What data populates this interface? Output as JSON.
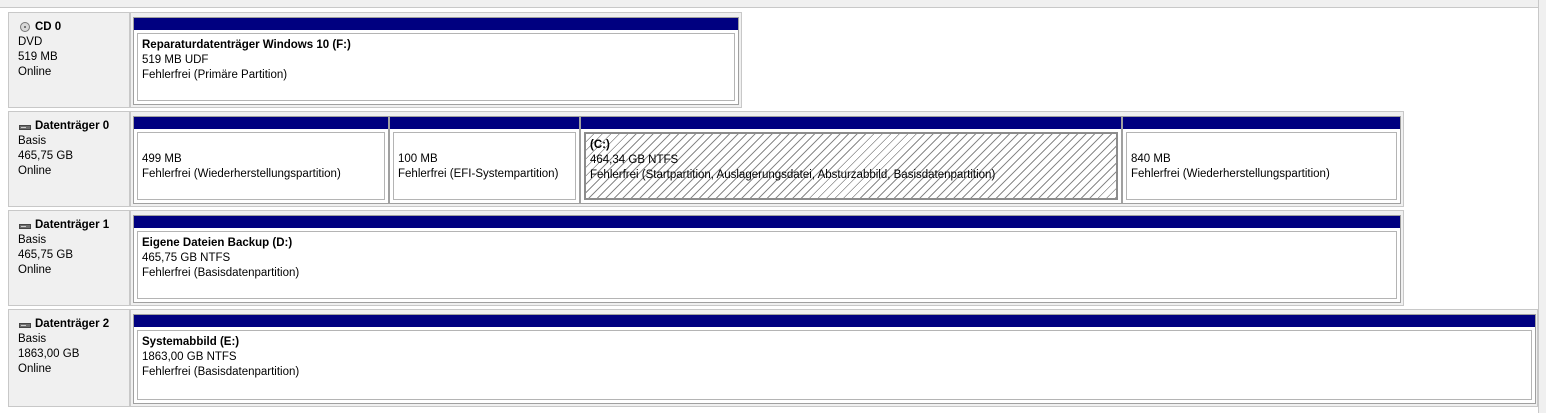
{
  "disks": [
    {
      "id": "cd0",
      "icon": "cd-icon",
      "name": "CD 0",
      "type": "DVD",
      "size": "519 MB",
      "status": "Online",
      "partitions": [
        {
          "name": "Reparaturdatenträger Windows 10   (F:)",
          "size_fs": "519 MB UDF",
          "status": "Fehlerfrei (Primäre Partition)"
        }
      ]
    },
    {
      "id": "disk0",
      "icon": "hard-disk-icon",
      "name": "Datenträger 0",
      "type": "Basis",
      "size": "465,75 GB",
      "status": "Online",
      "partitions": [
        {
          "name": "",
          "size_fs": "499 MB",
          "status": "Fehlerfrei (Wiederherstellungspartition)"
        },
        {
          "name": "",
          "size_fs": "100 MB",
          "status": "Fehlerfrei (EFI-Systempartition)"
        },
        {
          "name": "(C:)",
          "size_fs": "464,34 GB NTFS",
          "status": "Fehlerfrei (Startpartition, Auslagerungsdatei, Absturzabbild, Basisdatenpartition)"
        },
        {
          "name": "",
          "size_fs": "840 MB",
          "status": "Fehlerfrei (Wiederherstellungspartition)"
        }
      ]
    },
    {
      "id": "disk1",
      "icon": "hard-disk-icon",
      "name": "Datenträger 1",
      "type": "Basis",
      "size": "465,75 GB",
      "status": "Online",
      "partitions": [
        {
          "name": "Eigene Dateien Backup  (D:)",
          "size_fs": "465,75 GB NTFS",
          "status": "Fehlerfrei (Basisdatenpartition)"
        }
      ]
    },
    {
      "id": "disk2",
      "icon": "hard-disk-icon",
      "name": "Datenträger 2",
      "type": "Basis",
      "size": "1863,00 GB",
      "status": "Online",
      "partitions": [
        {
          "name": "Systemabbild  (E:)",
          "size_fs": "1863,00 GB NTFS",
          "status": "Fehlerfrei (Basisdatenpartition)"
        }
      ]
    }
  ],
  "colors": {
    "partition_bar": "#000080",
    "panel_bg": "#f0f0f0",
    "selected_hatch": "#8a8a8a"
  }
}
